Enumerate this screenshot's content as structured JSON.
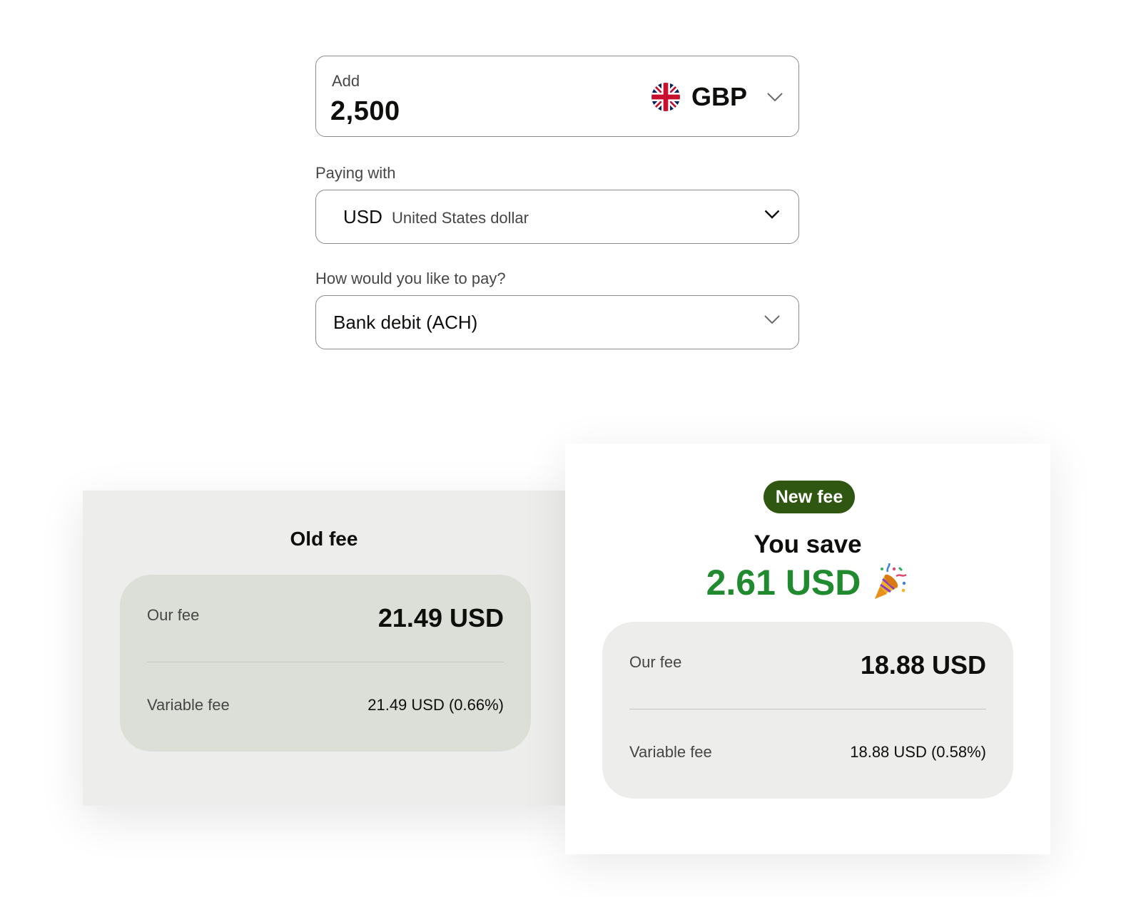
{
  "amount": {
    "label": "Add",
    "value": "2,500",
    "currency_code": "GBP",
    "currency_flag_icon": "uk-flag-icon"
  },
  "paying_with": {
    "label": "Paying with",
    "code": "USD",
    "name": "United States dollar"
  },
  "payment_method": {
    "label": "How would you like to pay?",
    "value": "Bank debit (ACH)"
  },
  "old_fee": {
    "title": "Old fee",
    "our_fee_label": "Our fee",
    "our_fee_value": "21.49 USD",
    "variable_fee_label": "Variable fee",
    "variable_fee_value": "21.49 USD (0.66%)"
  },
  "new_fee": {
    "badge": "New fee",
    "save_title": "You save",
    "save_amount": "2.61 USD",
    "save_icon": "party-popper-icon",
    "our_fee_label": "Our fee",
    "our_fee_value": "18.88 USD",
    "variable_fee_label": "Variable fee",
    "variable_fee_value": "18.88 USD (0.58%)"
  },
  "colors": {
    "badge_bg": "#2f5711",
    "savings_green": "#1f8a2e",
    "old_card_bg": "#edeeeb",
    "old_panel_bg": "#dcdfd8",
    "new_panel_bg": "#edeeeb"
  }
}
